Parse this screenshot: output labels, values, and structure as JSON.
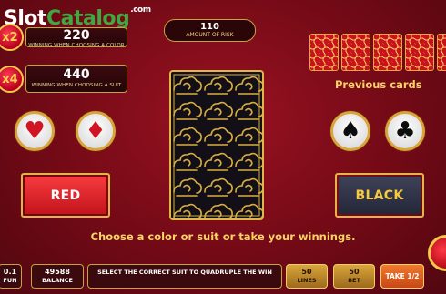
{
  "watermark": {
    "part1": "Slot",
    "part2": "Catalog",
    "suffix": ".com"
  },
  "color_row": {
    "multiplier": "x2",
    "value": "220",
    "label": "WINNING WHEN CHOOSING A COLOR"
  },
  "suit_row": {
    "multiplier": "x4",
    "value": "440",
    "label": "WINNING WHEN CHOOSING A SUIT"
  },
  "risk": {
    "value": "110",
    "label": "AMOUNT OF RISK"
  },
  "previous": {
    "label": "Previous cards",
    "count": 5
  },
  "buttons": {
    "red": "RED",
    "black": "BLACK"
  },
  "suits": {
    "heart": "♥",
    "diamond": "♦",
    "spade": "♠",
    "club": "♣"
  },
  "message": "Choose a color or suit or take your winnings.",
  "bottom": {
    "coin_value": "0.1",
    "coin_label": "FUN",
    "balance_value": "49588",
    "balance_label": "BALANCE",
    "note": "SELECT THE CORRECT SUIT TO QUADRUPLE THE WIN",
    "lines_value": "50",
    "lines_label": "LINES",
    "bet_value": "50",
    "bet_label": "BET",
    "take_label": "TAKE 1/2"
  },
  "colors": {
    "background": "#730a16",
    "gold": "#e0b648",
    "red_button": "#e0272d",
    "black_button": "#2e3045"
  }
}
